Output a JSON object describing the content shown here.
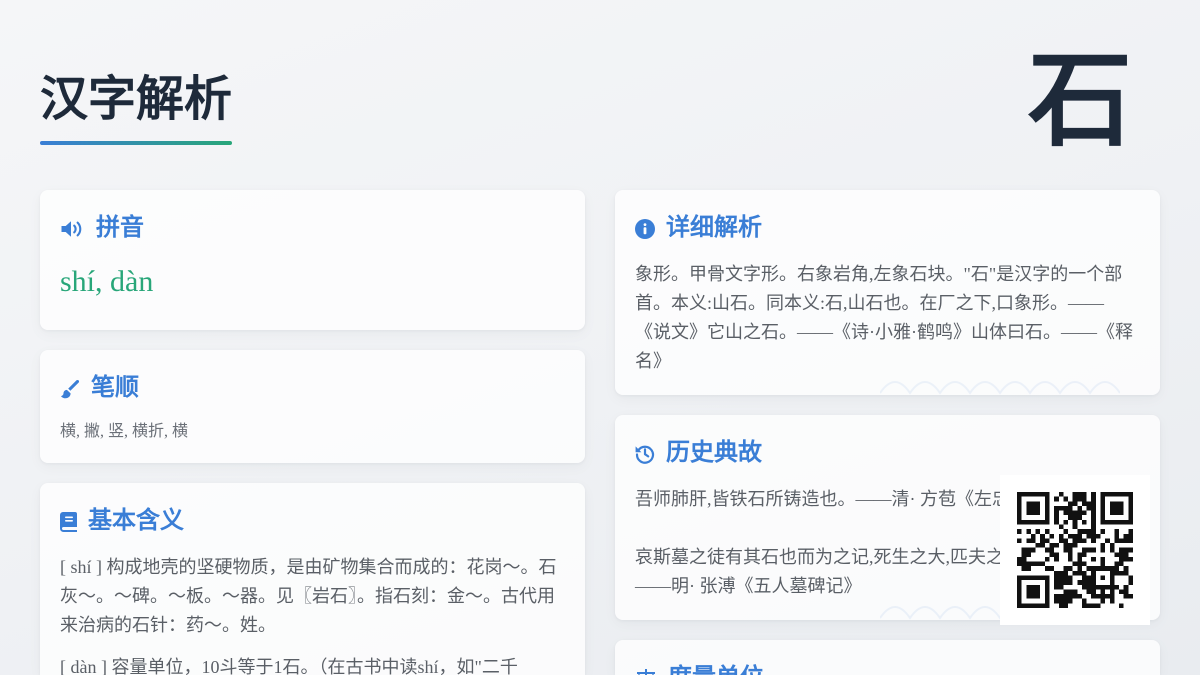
{
  "colors": {
    "title": "#1e2a3a",
    "accent_blue": "#3a7ed6",
    "accent_green": "#28a679",
    "body_text": "#5a5f66",
    "muted_text": "#6b7078"
  },
  "page": {
    "title": "汉字解析",
    "character": "石"
  },
  "pinyin": {
    "heading": "拼音",
    "icon": "volume-up-icon",
    "value": "shí, dàn"
  },
  "strokes": {
    "heading": "笔顺",
    "icon": "paintbrush-icon",
    "value": "横, 撇, 竖, 横折, 横"
  },
  "basic_meaning": {
    "heading": "基本含义",
    "icon": "book-icon",
    "paragraphs": [
      "[ shí ] 构成地壳的坚硬物质，是由矿物集合而成的：花岗～。石灰～。～碑。～板。～器。见〖岩石〗。指石刻：金～。古代用来治病的石针：药～。姓。",
      "[ dàn ] 容量单位，10斗等于1石。（在古书中读shí，如\"二千"
    ]
  },
  "detailed_analysis": {
    "heading": "详细解析",
    "icon": "info-circle-icon",
    "text": "象形。甲骨文字形。右象岩角,左象石块。\"石\"是汉字的一个部首。本义:山石。同本义:石,山石也。在厂之下,口象形。——《说文》它山之石。——《诗·小雅·鹤鸣》山体曰石。——《释名》"
  },
  "history": {
    "heading": "历史典故",
    "icon": "history-icon",
    "entries": [
      {
        "quote": "吾师肺肝,皆铁石所铸造也。",
        "source": "——清· 方苞《左忠"
      },
      {
        "quote": "哀斯墓之徒有其石也而为之记,死生之大,匹夫之",
        "source": "——明· 张溥《五人墓碑记》"
      }
    ]
  },
  "measurement_units": {
    "heading": "度量单位",
    "icon": "balance-scale-icon"
  },
  "qr_code": {
    "icon": "qr-code"
  }
}
